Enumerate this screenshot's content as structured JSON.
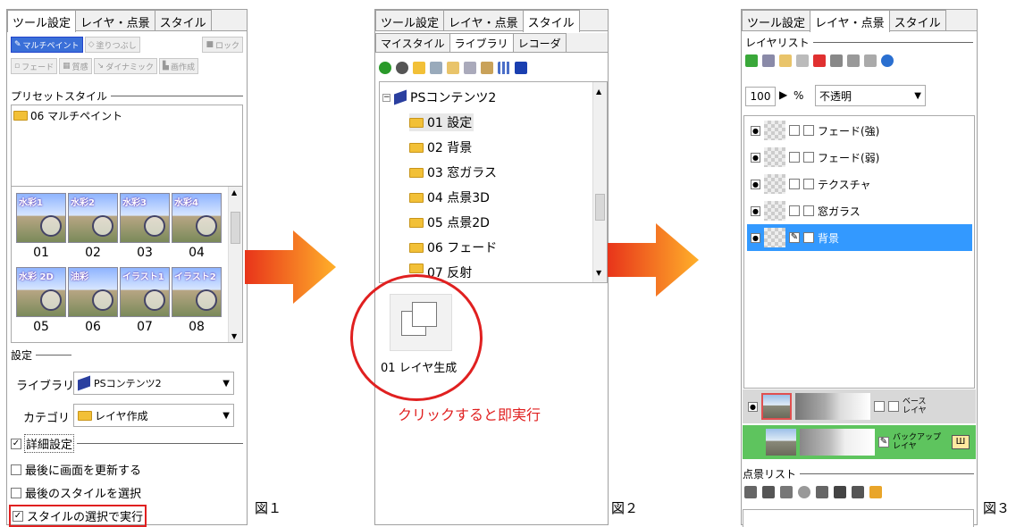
{
  "panel1": {
    "tabs": [
      "ツール設定",
      "レイヤ・点景",
      "スタイル"
    ],
    "tool_buttons_row1": [
      "マルチペイント",
      "塗りつぶし",
      "ロック"
    ],
    "tool_buttons_row2": [
      "フェード",
      "質感",
      "ダイナミック",
      "画作成"
    ],
    "preset_section": "プリセットスタイル",
    "preset_item": "06 マルチペイント",
    "thumbnails": [
      {
        "label": "水彩1",
        "num": "01"
      },
      {
        "label": "水彩2",
        "num": "02"
      },
      {
        "label": "水彩3",
        "num": "03"
      },
      {
        "label": "水彩4",
        "num": "04"
      },
      {
        "label": "水彩 2D",
        "num": "05"
      },
      {
        "label": "油彩",
        "num": "06"
      },
      {
        "label": "イラスト1",
        "num": "07"
      },
      {
        "label": "イラスト2",
        "num": "08"
      }
    ],
    "settings_section": "設定",
    "library_label": "ライブラリ",
    "library_value": "PSコンテンツ2",
    "category_label": "カテゴリ",
    "category_value": "レイヤ作成",
    "detail_label": "詳細設定",
    "opt1": "最後に画面を更新する",
    "opt2": "最後のスタイルを選択",
    "opt3": "スタイルの選択で実行"
  },
  "panel2": {
    "tabs": [
      "ツール設定",
      "レイヤ・点景",
      "スタイル"
    ],
    "subtabs": [
      "マイスタイル",
      "ライブラリ",
      "レコーダ"
    ],
    "tree_root": "PSコンテンツ2",
    "tree_items": [
      "01 設定",
      "02 背景",
      "03 窓ガラス",
      "04 点景3D",
      "05 点景2D",
      "06 フェード",
      "07 反射"
    ],
    "style_item": "01 レイヤ生成",
    "callout": "クリックすると即実行"
  },
  "panel3": {
    "tabs": [
      "ツール設定",
      "レイヤ・点景",
      "スタイル"
    ],
    "layer_list_section": "レイヤリスト",
    "opacity": "100",
    "opacity_unit": "%",
    "blend_mode": "不透明",
    "layers": [
      "フェード(強)",
      "フェード(弱)",
      "テクスチャ",
      "窓ガラス",
      "背景"
    ],
    "base_layer_label": "ベース\nレイヤ",
    "backup_layer_label": "バックアップ\nレイヤ",
    "scene_list_section": "点景リスト"
  },
  "figs": [
    "図１",
    "図２",
    "図３"
  ],
  "colors": {
    "selected": "#3399ff",
    "callout_red": "#e02020",
    "backup_green": "#5ec45e",
    "arrow_orange": "#f06a1a"
  }
}
